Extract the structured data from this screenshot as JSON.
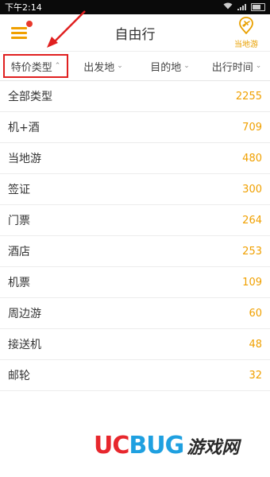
{
  "status": {
    "time": "下午2:14"
  },
  "header": {
    "title": "自由行",
    "local_label": "当地游"
  },
  "filters": [
    {
      "label": "特价类型",
      "chevron": "⌃"
    },
    {
      "label": "出发地",
      "chevron": "⌄"
    },
    {
      "label": "目的地",
      "chevron": "⌄"
    },
    {
      "label": "出行时间",
      "chevron": "⌄"
    }
  ],
  "categories": [
    {
      "label": "全部类型",
      "count": "2255"
    },
    {
      "label": "机+酒",
      "count": "709"
    },
    {
      "label": "当地游",
      "count": "480"
    },
    {
      "label": "签证",
      "count": "300"
    },
    {
      "label": "门票",
      "count": "264"
    },
    {
      "label": "酒店",
      "count": "253"
    },
    {
      "label": "机票",
      "count": "109"
    },
    {
      "label": "周边游",
      "count": "60"
    },
    {
      "label": "接送机",
      "count": "48"
    },
    {
      "label": "邮轮",
      "count": "32"
    }
  ],
  "watermark": {
    "part1": "UC",
    "part2": "BUG",
    "part3": "游戏网"
  },
  "colors": {
    "accent": "#f0a000",
    "annotation": "#e02020",
    "badge": "#e8392b"
  },
  "icons": {
    "menu": "hamburger-icon",
    "local": "location-plane-icon"
  }
}
